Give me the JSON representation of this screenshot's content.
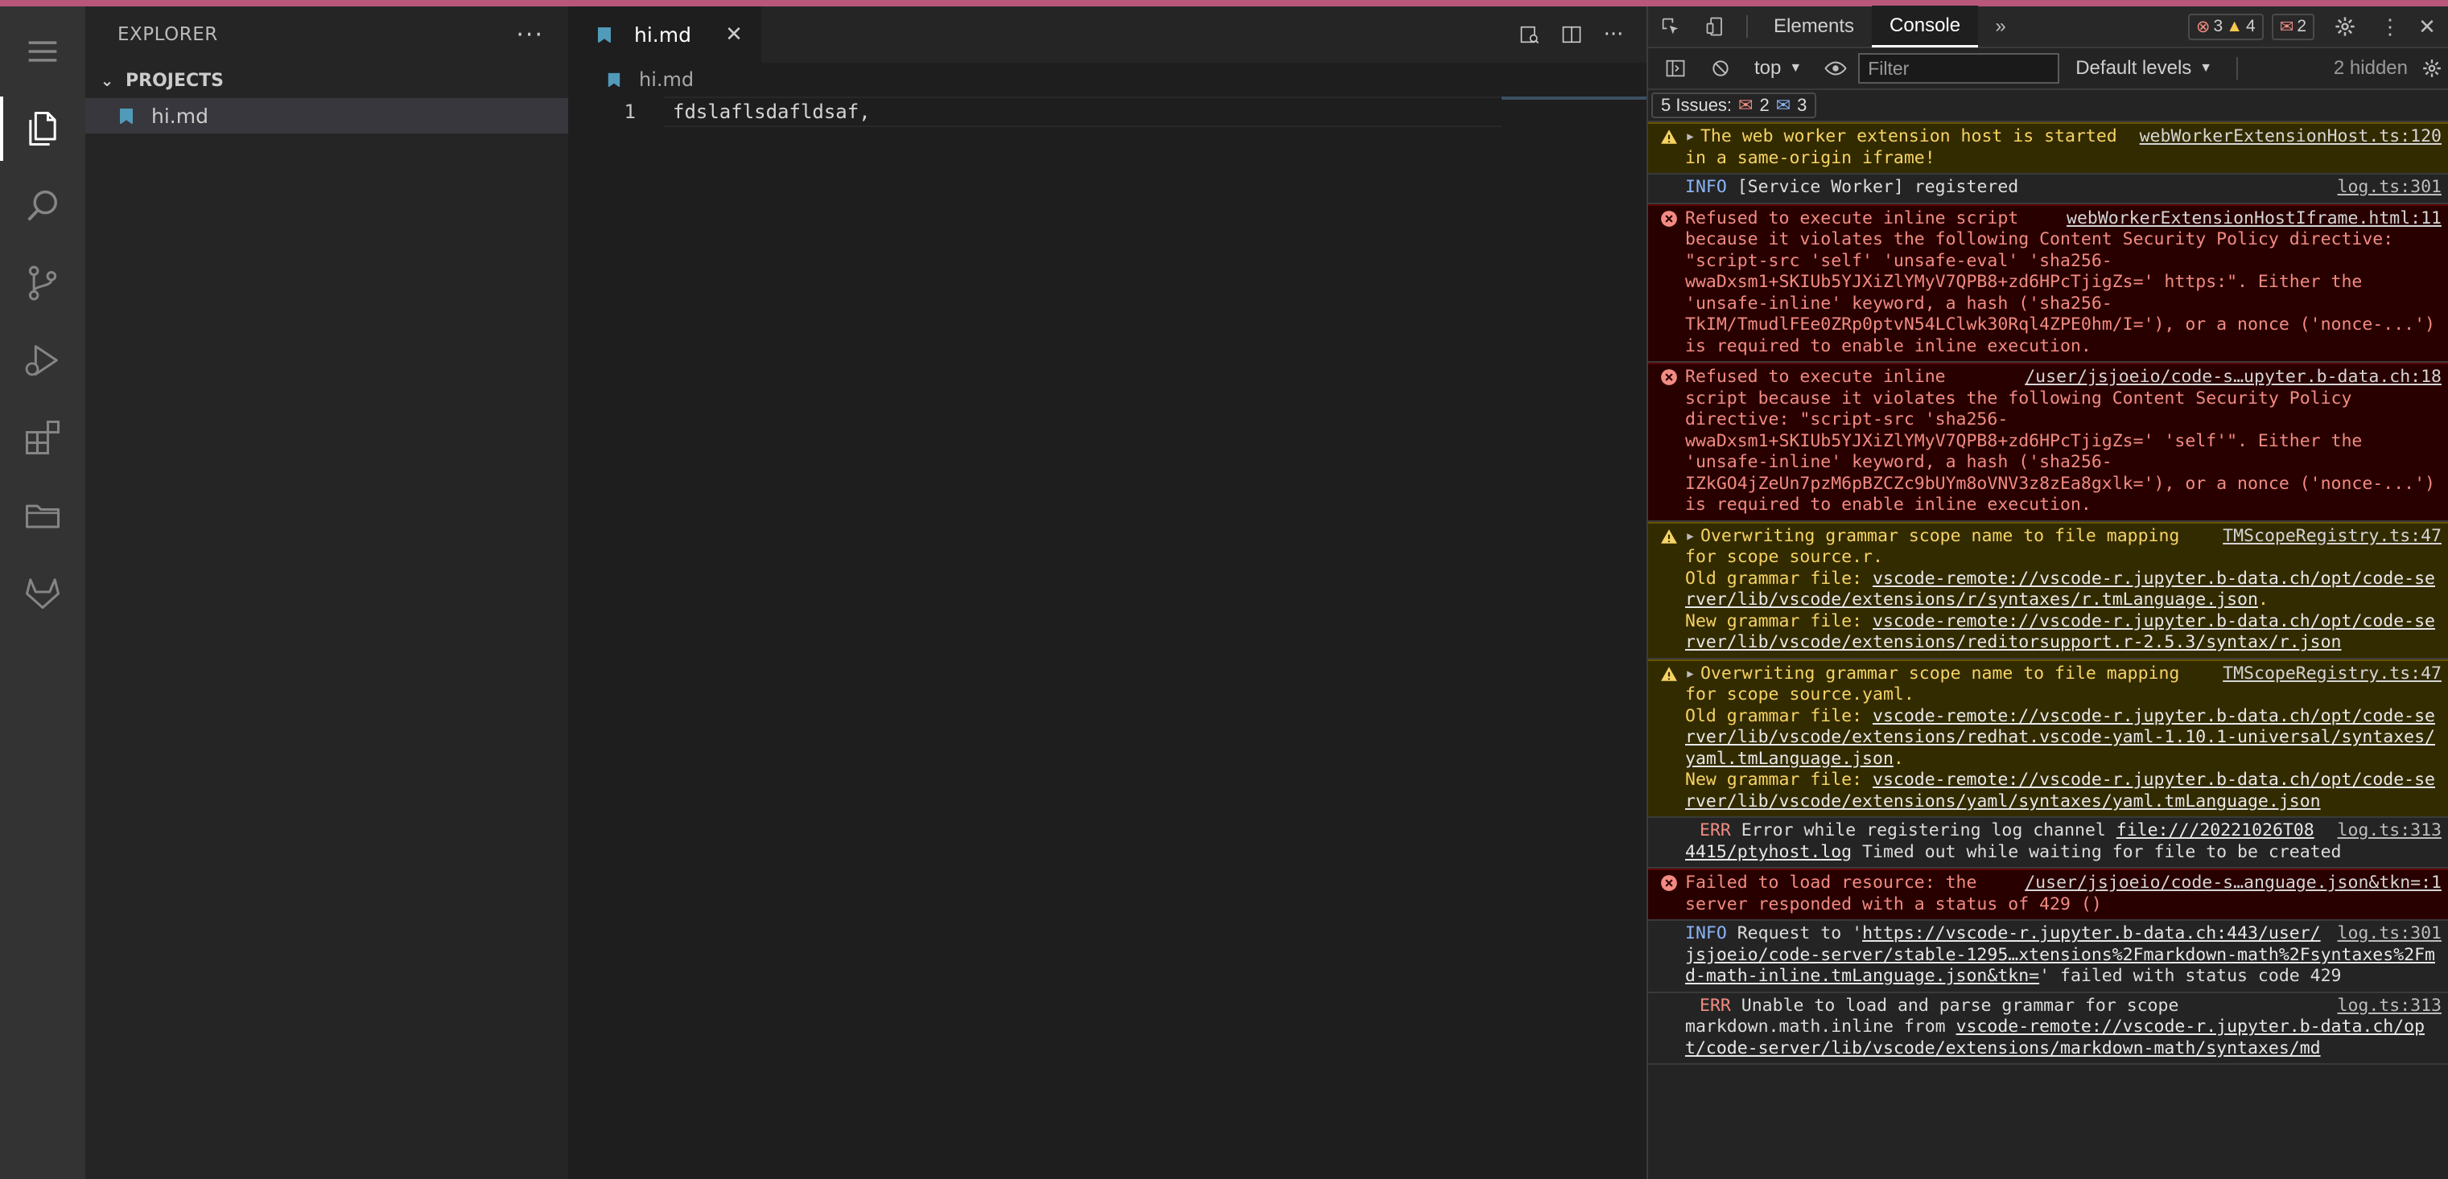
{
  "activity_bar": {
    "items": [
      {
        "name": "menu-icon"
      },
      {
        "name": "explorer-icon",
        "active": true
      },
      {
        "name": "search-icon"
      },
      {
        "name": "source-control-icon"
      },
      {
        "name": "run-debug-icon"
      },
      {
        "name": "extensions-icon"
      },
      {
        "name": "remote-explorer-icon"
      },
      {
        "name": "gitlab-icon"
      }
    ]
  },
  "sidebar": {
    "title": "EXPLORER",
    "more": "···",
    "section": "PROJECTS",
    "files": [
      {
        "name": "hi.md"
      }
    ]
  },
  "editor": {
    "tab": {
      "label": "hi.md",
      "close": "✕"
    },
    "breadcrumb": "hi.md",
    "lines": [
      {
        "number": "1",
        "text": "fdslaflsdafldsaf,"
      }
    ]
  },
  "devtools": {
    "tabs": {
      "elements": "Elements",
      "console": "Console"
    },
    "counters": {
      "errors": "3",
      "warnings": "4",
      "issues": "2"
    },
    "context": "top",
    "filter_placeholder": "Filter",
    "levels": "Default levels",
    "hidden": "2 hidden",
    "issues_bar": {
      "label": "5 Issues:",
      "errors": "2",
      "infos": "3"
    },
    "messages": [
      {
        "type": "warning",
        "text": "The web worker extension host is started in a same-origin iframe!",
        "source": "webWorkerExtensionHost.ts:120"
      },
      {
        "type": "info",
        "level": "INFO",
        "text": "[Service Worker] registered",
        "source": "log.ts:301"
      },
      {
        "type": "error",
        "text": "Refused to execute inline script because it violates the following Content Security Policy directive: \"script-src 'self' 'unsafe-eval' 'sha256-wwaDxsm1+SKIUb5YJXiZlYMyV7QPB8+zd6HPcTjigZs=' https:\". Either the 'unsafe-inline' keyword, a hash ('sha256-TkIM/TmudlFEe0ZRp0ptvN54LClwk30Rql4ZPE0hm/I='), or a nonce ('nonce-...') is required to enable inline execution.",
        "source": "webWorkerExtensionHostIframe.html:11"
      },
      {
        "type": "error",
        "text": "Refused to execute inline script because it violates the following Content Security Policy directive: \"script-src 'sha256-wwaDxsm1+SKIUb5YJXiZlYMyV7QPB8+zd6HPcTjigZs=' 'self'\". Either the 'unsafe-inline' keyword, a hash ('sha256-IZkGO4jZeUn7pzM6pBZCZc9bUYm8oVNV3z8zEa8gxlk='), or a nonce ('nonce-...') is required to enable inline execution.",
        "source": "/user/jsjoeio/code-s…upyter.b-data.ch:18"
      },
      {
        "type": "warning",
        "text": "Overwriting grammar scope name to file mapping for scope source.r.",
        "old_label": "Old grammar file:",
        "old_link": "vscode-remote://vscode-r.jupyter.b-data.ch/opt/code-server/lib/vscode/extensions/r/syntaxes/r.tmLanguage.json",
        "new_label": "New grammar file:",
        "new_link": "vscode-remote://vscode-r.jupyter.b-data.ch/opt/code-server/lib/vscode/extensions/reditorsupport.r-2.5.3/syntax/r.json",
        "source": "TMScopeRegistry.ts:47"
      },
      {
        "type": "warning",
        "text": "Overwriting grammar scope name to file mapping for scope source.yaml.",
        "old_label": "Old grammar file:",
        "old_link": "vscode-remote://vscode-r.jupyter.b-data.ch/opt/code-server/lib/vscode/extensions/redhat.vscode-yaml-1.10.1-universal/syntaxes/yaml.tmLanguage.json",
        "new_label": "New grammar file:",
        "new_link": "vscode-remote://vscode-r.jupyter.b-data.ch/opt/code-server/lib/vscode/extensions/yaml/syntaxes/yaml.tmLanguage.json",
        "source": "TMScopeRegistry.ts:47"
      },
      {
        "type": "info",
        "level": "ERR",
        "text": "Error while registering log channel",
        "link": "file:///20221026T084415/ptyhost.log",
        "after": " Timed out while waiting for file to be created",
        "source": "log.ts:313"
      },
      {
        "type": "error",
        "text": "Failed to load resource: the server responded with a status of 429 ()",
        "source": "/user/jsjoeio/code-s…anguage.json&tkn=:1"
      },
      {
        "type": "info",
        "level": "INFO",
        "text": "Request to '",
        "link": "https://vscode-r.jupyter.b-data.ch:443/user/jsjoeio/code-server/stable-1295…xtensions%2Fmarkdown-math%2Fsyntaxes%2Fmd-math-inline.tmLanguage.json&tkn=",
        "after": "' failed with status code 429",
        "source": "log.ts:301"
      },
      {
        "type": "info",
        "level": "ERR",
        "text": "Unable to load and parse grammar for scope markdown.math.inline from",
        "link": "vscode-remote://vscode-r.jupyter.b-data.ch/opt/code-server/lib/vscode/extensions/markdown-math/syntaxes/md",
        "after": "",
        "source": "log.ts:313"
      }
    ]
  }
}
